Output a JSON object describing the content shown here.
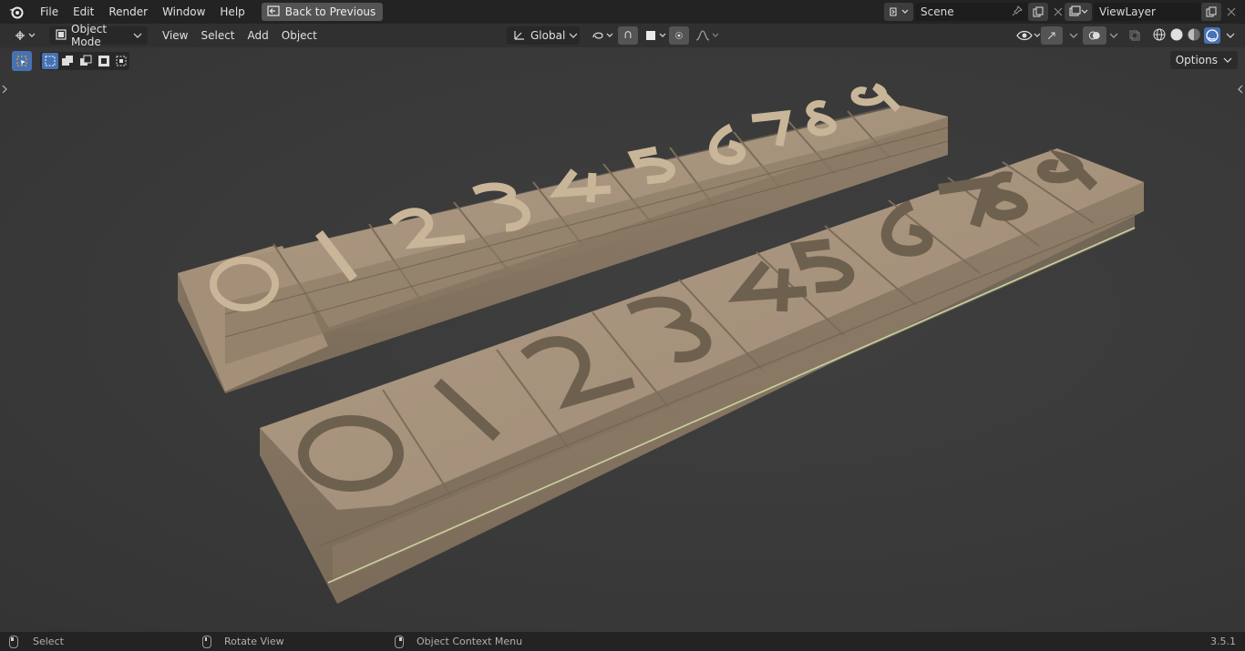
{
  "topbar": {
    "menu": [
      "File",
      "Edit",
      "Render",
      "Window",
      "Help"
    ],
    "back_button": "Back to Previous",
    "scene_name": "Scene",
    "view_layer_name": "ViewLayer"
  },
  "header": {
    "mode": "Object Mode",
    "menu": [
      "View",
      "Select",
      "Add",
      "Object"
    ],
    "transform_orientation": "Global",
    "options_label": "Options"
  },
  "viewport": {
    "back_strip_digits": [
      "0",
      "1",
      "2",
      "3",
      "4",
      "5",
      "6",
      "7",
      "8",
      "9"
    ],
    "front_strip_digits": [
      "0",
      "1",
      "2",
      "3",
      "4",
      "5",
      "6",
      "7",
      "8",
      "9"
    ]
  },
  "statusbar": {
    "left_click": "Select",
    "middle_click": "Rotate View",
    "right_click": "Object Context Menu",
    "version": "3.5.1"
  },
  "colors": {
    "accent": "#4772b3",
    "tile": "#a8937c",
    "edge_highlight": "#c8d3a0"
  },
  "icons": [
    "blender-logo-icon",
    "back-icon",
    "scene-icon",
    "pin-icon",
    "copy-icon",
    "close-icon",
    "view-layer-icon",
    "editor-type-icon",
    "object-mode-icon",
    "orientation-icon",
    "pivot-icon",
    "snap-icon",
    "proportional-icon",
    "visibility-icon",
    "gizmo-icon",
    "overlay-icon",
    "xray-icon",
    "wireframe-shading-icon",
    "solid-shading-icon",
    "material-shading-icon",
    "rendered-shading-icon",
    "select-tool-icon",
    "select-mode-icons"
  ]
}
